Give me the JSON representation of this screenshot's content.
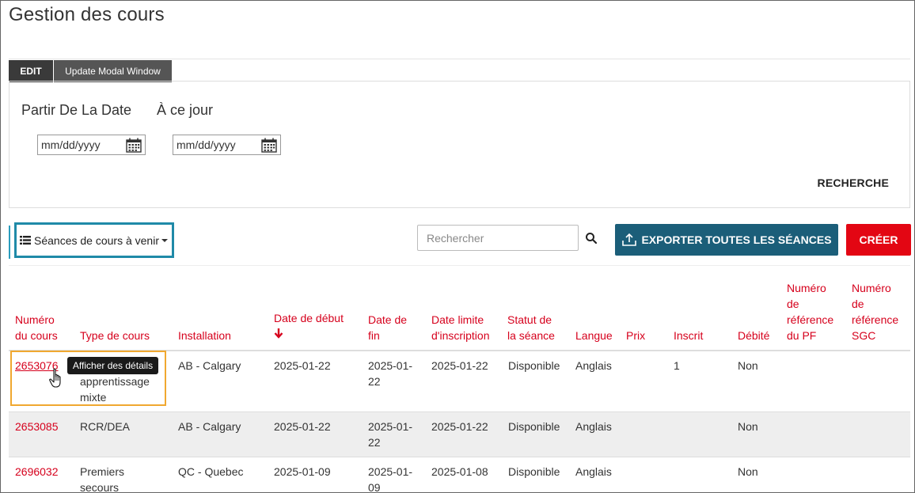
{
  "page": {
    "title": "Gestion des cours"
  },
  "tabs": [
    {
      "label": "EDIT"
    },
    {
      "label": "Update Modal Window"
    }
  ],
  "filters": {
    "start_label": "Partir De La Date",
    "end_label": "À ce jour",
    "start_placeholder": "mm/dd/yyyy",
    "end_placeholder": "mm/dd/yyyy",
    "search_button": "RECHERCHE"
  },
  "toolbar": {
    "view_selector": "Séances de cours à venir",
    "search_placeholder": "Rechercher",
    "export_label": "EXPORTER TOUTES LES SÉANCES",
    "create_label": "CRÉER"
  },
  "table": {
    "headers": {
      "course_number": [
        "Numéro",
        "du cours"
      ],
      "course_type": "Type de cours",
      "installation": "Installation",
      "start_date": "Date de début",
      "end_date": [
        "Date de",
        "fin"
      ],
      "deadline": [
        "Date limite",
        "d'inscription"
      ],
      "status": [
        "Statut de",
        "la séance"
      ],
      "language": "Langue",
      "price": "Prix",
      "registered": "Inscrit",
      "debited": "Débité",
      "pf_ref": [
        "Numéro",
        "de",
        "référence",
        "du PF"
      ],
      "sgc_ref": [
        "Numéro",
        "de",
        "référence",
        "SGC"
      ]
    },
    "rows": [
      {
        "course_number": "2653076",
        "course_type_lines": [
          "apprentissage",
          "mixte"
        ],
        "installation": "AB - Calgary",
        "start_date": "2025-01-22",
        "end_date_lines": [
          "2025-01-",
          "22"
        ],
        "deadline": "2025-01-22",
        "status": "Disponible",
        "language": "Anglais",
        "price": "",
        "registered": "1",
        "debited": "Non"
      },
      {
        "course_number": "2653085",
        "course_type_lines": [
          "RCR/DEA"
        ],
        "installation": "AB - Calgary",
        "start_date": "2025-01-22",
        "end_date_lines": [
          "2025-01-",
          "22"
        ],
        "deadline": "2025-01-22",
        "status": "Disponible",
        "language": "Anglais",
        "price": "",
        "registered": "",
        "debited": "Non"
      },
      {
        "course_number": "2696032",
        "course_type_lines": [
          "Premiers",
          "secours"
        ],
        "installation": "QC - Quebec",
        "start_date": "2025-01-09",
        "end_date_lines": [
          "2025-01-",
          "09"
        ],
        "deadline": "2025-01-08",
        "status": "Disponible",
        "language": "Anglais",
        "price": "",
        "registered": "",
        "debited": "Non"
      }
    ]
  },
  "tooltip": {
    "text": "Afficher des détails"
  },
  "colors": {
    "accent_red": "#d6001c",
    "export_blue": "#1b5e79",
    "create_red": "#e30613",
    "highlight_orange": "#f0a830",
    "selector_border": "#1f8aa8"
  }
}
